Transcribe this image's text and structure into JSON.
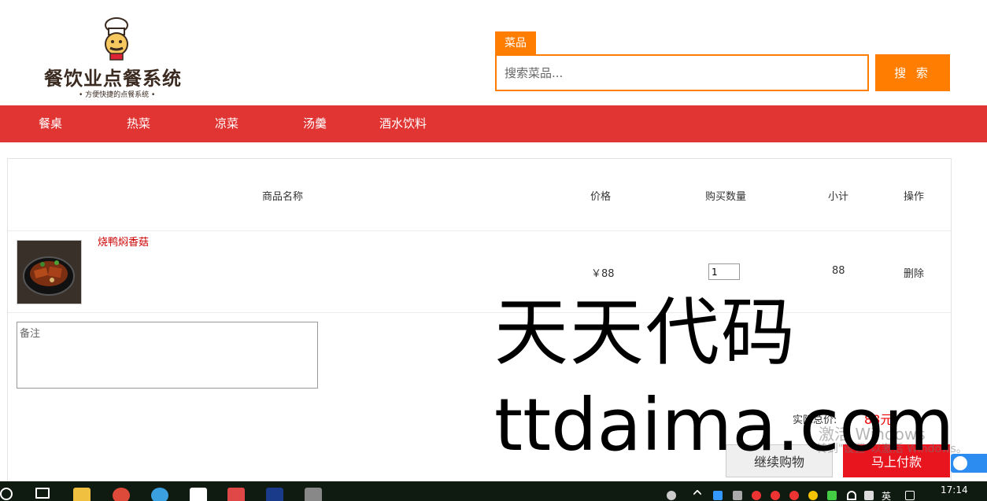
{
  "logo": {
    "title": "餐饮业点餐系统",
    "subtitle": "• 方便快捷的点餐系统 •"
  },
  "search": {
    "tab_label": "菜品",
    "placeholder": "搜索菜品...",
    "button_label": "搜 索"
  },
  "nav": {
    "items": [
      {
        "label": "餐桌"
      },
      {
        "label": "热菜"
      },
      {
        "label": "凉菜"
      },
      {
        "label": "汤羹"
      },
      {
        "label": "酒水饮料"
      }
    ]
  },
  "cart": {
    "headers": {
      "name": "商品名称",
      "price": "价格",
      "quantity": "购买数量",
      "subtotal": "小计",
      "action": "操作"
    },
    "items": [
      {
        "name": "烧鸭焖香菇",
        "price": "￥88",
        "quantity": "1",
        "subtotal": "88",
        "action": "删除"
      }
    ],
    "remark_placeholder": "备注",
    "total_label": "实际总价:",
    "total_value": "88元",
    "continue_label": "继续购物",
    "pay_label": "马上付款"
  },
  "watermark": {
    "line1": "天天代码",
    "line2": "ttdaima.com"
  },
  "windows_activation": {
    "line1": "激活 Windows",
    "line2": "转到\"设置\"以激活 Windows。"
  },
  "taskbar": {
    "clock": "17:14",
    "ime": "英"
  },
  "colors": {
    "accent_orange": "#ff7d00",
    "nav_red": "#e03533",
    "pay_red": "#e8141e",
    "price_red": "#e00000"
  }
}
